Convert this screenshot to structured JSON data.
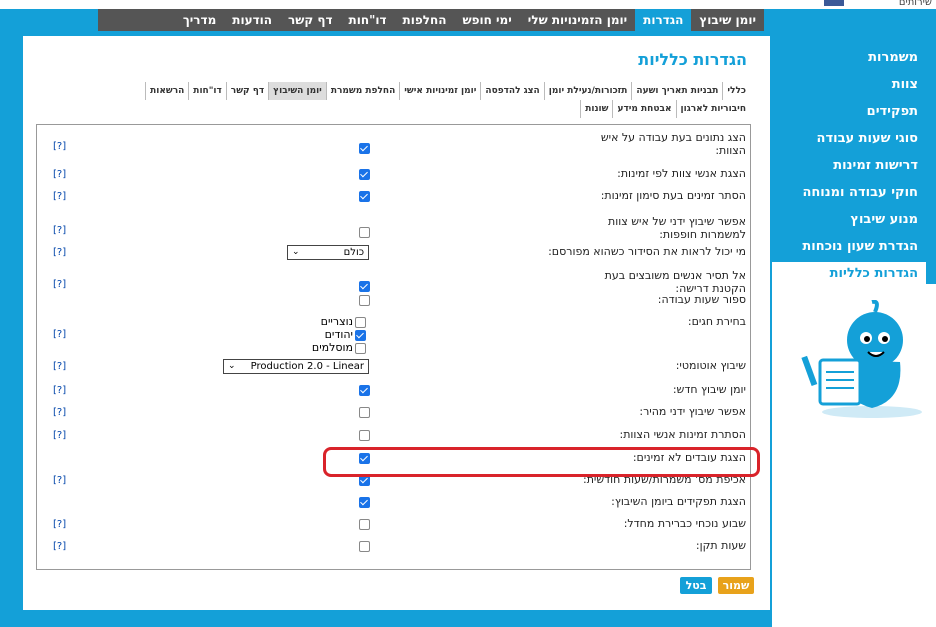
{
  "top": {
    "site_text": "שירותים"
  },
  "nav": {
    "items": [
      "יומן שיבוץ",
      "הגדרות",
      "יומן הזמינויות שלי",
      "ימי חופש",
      "החלפות",
      "דו\"חות",
      "דף קשר",
      "הודעות",
      "מדריך"
    ],
    "active_index": 1
  },
  "sidebar": {
    "items": [
      "משמרות",
      "צוות",
      "תפקידים",
      "סוגי שעות עבודה",
      "דרישות זמינות",
      "חוקי עבודה ומנוחה",
      "מנוע שיבוץ",
      "הגדרת שעון נוכחות",
      "הגדרות כלליות"
    ],
    "active_index": 8
  },
  "page": {
    "title": "הגדרות כלליות"
  },
  "subtabs": {
    "row1": [
      "כללי",
      "תבניות תאריך ושעה",
      "תזכורות/נעילת יומן",
      "הצג להדפסה",
      "יומן זמינויות אישי",
      "החלפת משמרת",
      "יומן השיבוץ",
      "דף קשר",
      "דו\"חות",
      "הרשאות"
    ],
    "row1_selected": 6,
    "row2": [
      "חיבוריות לארגון",
      "אבטחת מידע",
      "שונות"
    ]
  },
  "settings": [
    {
      "label": "הצג נתונים בעת עבודה על איש הצוות:",
      "type": "checkbox",
      "checked": true,
      "help": "[?]"
    },
    {
      "label": "הצגת אנשי צוות לפי זמינות:",
      "type": "checkbox",
      "checked": true,
      "help": "[?]"
    },
    {
      "label": "הסתר זמינים בעת סימון זמינות:",
      "type": "checkbox",
      "checked": true,
      "help": "[?]"
    },
    {
      "label": "אפשר שיבוץ ידני של איש צוות למשמרות חופפות:",
      "type": "checkbox",
      "checked": false,
      "help": "[?]"
    },
    {
      "label": "מי יכול לראות את הסידור כשהוא מפורסם:",
      "type": "select",
      "value": "כולם",
      "help": "[?]"
    },
    {
      "label": "אל תסיר אנשים משובצים בעת הקטנת דרישה:",
      "type": "checkbox",
      "checked": true,
      "help": "[?]"
    },
    {
      "label": "ספור שעות עבודה:",
      "type": "checkbox",
      "checked": false,
      "help": ""
    },
    {
      "label": "בחירת חגים:",
      "type": "holidays",
      "help": "[?]"
    },
    {
      "label": "שיבוץ אוטומטי:",
      "type": "select",
      "value": "Production 2.0 - Linear",
      "help": "[?]"
    },
    {
      "label": "יומן שיבוץ חדש:",
      "type": "checkbox",
      "checked": true,
      "help": "[?]"
    },
    {
      "label": "אפשר שיבוץ ידני מהיר:",
      "type": "checkbox",
      "checked": false,
      "help": "[?]"
    },
    {
      "label": "הסתרת זמינות אנשי הצוות:",
      "type": "checkbox",
      "checked": false,
      "help": "[?]"
    },
    {
      "label": "הצגת עובדים לא זמינים:",
      "type": "checkbox",
      "checked": true,
      "help": ""
    },
    {
      "label": "אכיפת מס' משמרות/שעות חודשית:",
      "type": "checkbox",
      "checked": true,
      "help": "[?]"
    },
    {
      "label": "הצגת תפקידים ביומן השיבוץ:",
      "type": "checkbox",
      "checked": true,
      "help": ""
    },
    {
      "label": "שבוע נוכחי כברירת מחדל:",
      "type": "checkbox",
      "checked": false,
      "help": "[?]"
    },
    {
      "label": "שעות תקן:",
      "type": "checkbox",
      "checked": false,
      "help": "[?]"
    }
  ],
  "holidays": [
    {
      "label": "נוצריים",
      "checked": false
    },
    {
      "label": "יהודים",
      "checked": true
    },
    {
      "label": "מוסלמים",
      "checked": false
    }
  ],
  "buttons": {
    "save": "שמור",
    "cancel": "בטל"
  },
  "colors": {
    "brand": "#14a0d8",
    "nav_bg": "#555555",
    "highlight": "#d9232a",
    "save": "#e8a21b"
  }
}
